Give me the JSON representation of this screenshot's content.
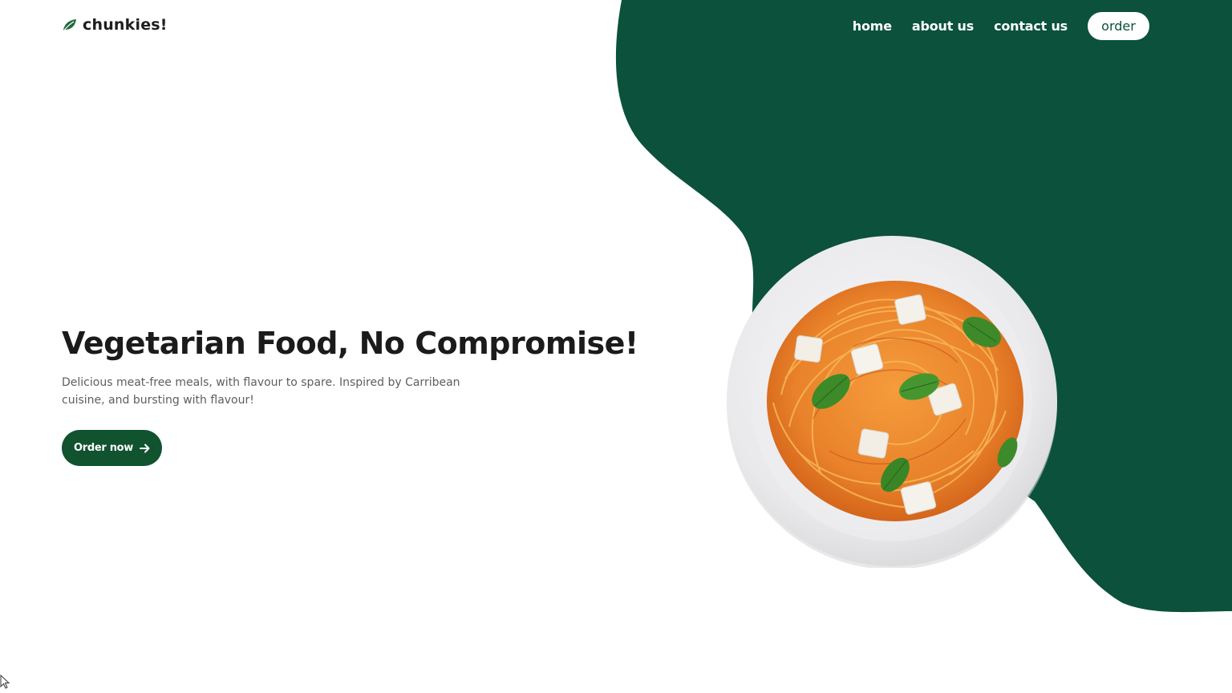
{
  "brand": {
    "name": "chunkies!",
    "logo_icon": "leaf-icon"
  },
  "nav": {
    "items": [
      {
        "label": "home"
      },
      {
        "label": "about us"
      },
      {
        "label": "contact us"
      }
    ],
    "order_label": "order"
  },
  "hero": {
    "title": "Vegetarian Food, No Compromise!",
    "description": "Delicious meat-free meals, with flavour to spare. Inspired by Carribean cuisine, and bursting with flavour!",
    "cta_label": "Order now",
    "cta_icon": "arrow-right-icon",
    "image": "spaghetti-plate-image"
  },
  "colors": {
    "brand_green": "#0b513c",
    "button_green": "#11522f",
    "text_dark": "#1b1b1b",
    "text_muted": "#5e5e5e",
    "background": "#ffffff"
  }
}
